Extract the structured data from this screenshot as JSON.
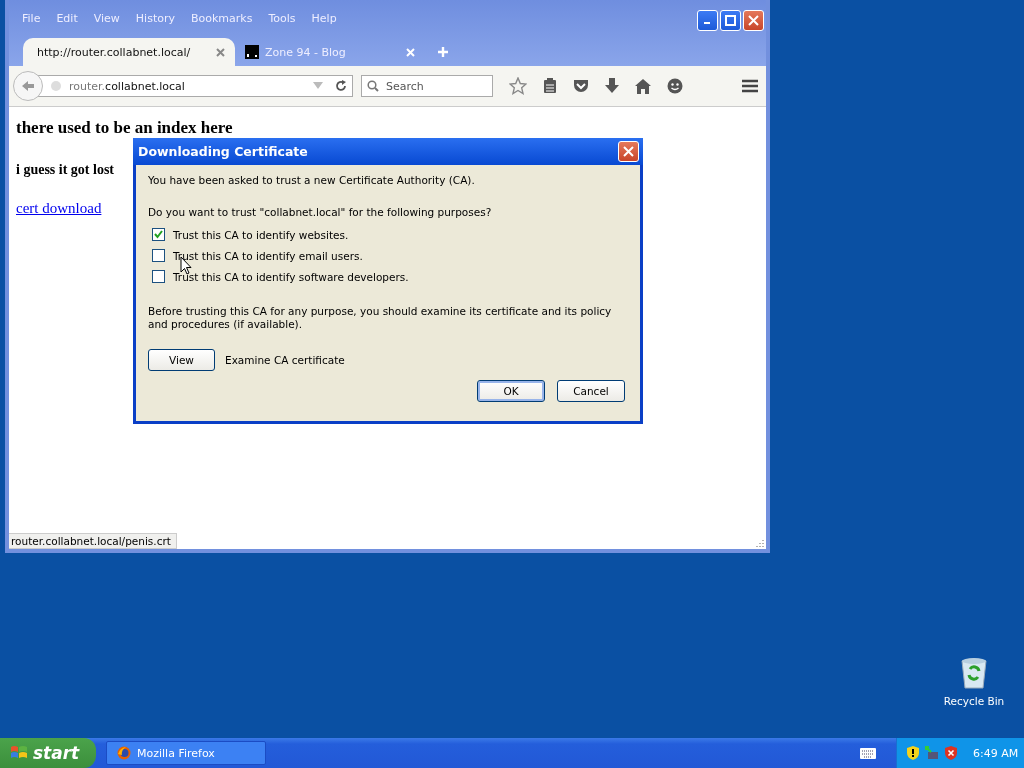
{
  "browser": {
    "menu": [
      "File",
      "Edit",
      "View",
      "History",
      "Bookmarks",
      "Tools",
      "Help"
    ],
    "tabs": [
      {
        "title": "http://router.collabnet.local/",
        "selected": true
      },
      {
        "title": "Zone 94 - Blog",
        "selected": false
      }
    ],
    "url": {
      "subdomain": "router.",
      "domain": "collabnet.local"
    },
    "search": {
      "placeholder": "Search"
    },
    "page": {
      "heading": "there used to be an index here",
      "text": "i guess it got lost",
      "link": "cert download"
    },
    "status": "router.collabnet.local/penis.crt"
  },
  "dialog": {
    "title": "Downloading Certificate",
    "intro": "You have been asked to trust a new Certificate Authority (CA).",
    "question": "Do you want to trust \"collabnet.local\" for the following purposes?",
    "options": [
      {
        "label": "Trust this CA to identify websites.",
        "checked": true
      },
      {
        "label": "Trust this CA to identify email users.",
        "checked": false
      },
      {
        "label": "Trust this CA to identify software developers.",
        "checked": false
      }
    ],
    "note": "Before trusting this CA for any purpose, you should examine its certificate and its policy and procedures (if available).",
    "view_button": "View",
    "view_label": "Examine CA certificate",
    "buttons": [
      {
        "label": "OK",
        "default": true
      },
      {
        "label": "Cancel",
        "default": false
      }
    ]
  },
  "desktop": {
    "icons": [
      {
        "label": "Recycle Bin"
      }
    ]
  },
  "taskbar": {
    "start": "start",
    "tasks": [
      {
        "label": "Mozilla Firefox",
        "selected": false
      }
    ],
    "clock": "6:49 AM"
  }
}
